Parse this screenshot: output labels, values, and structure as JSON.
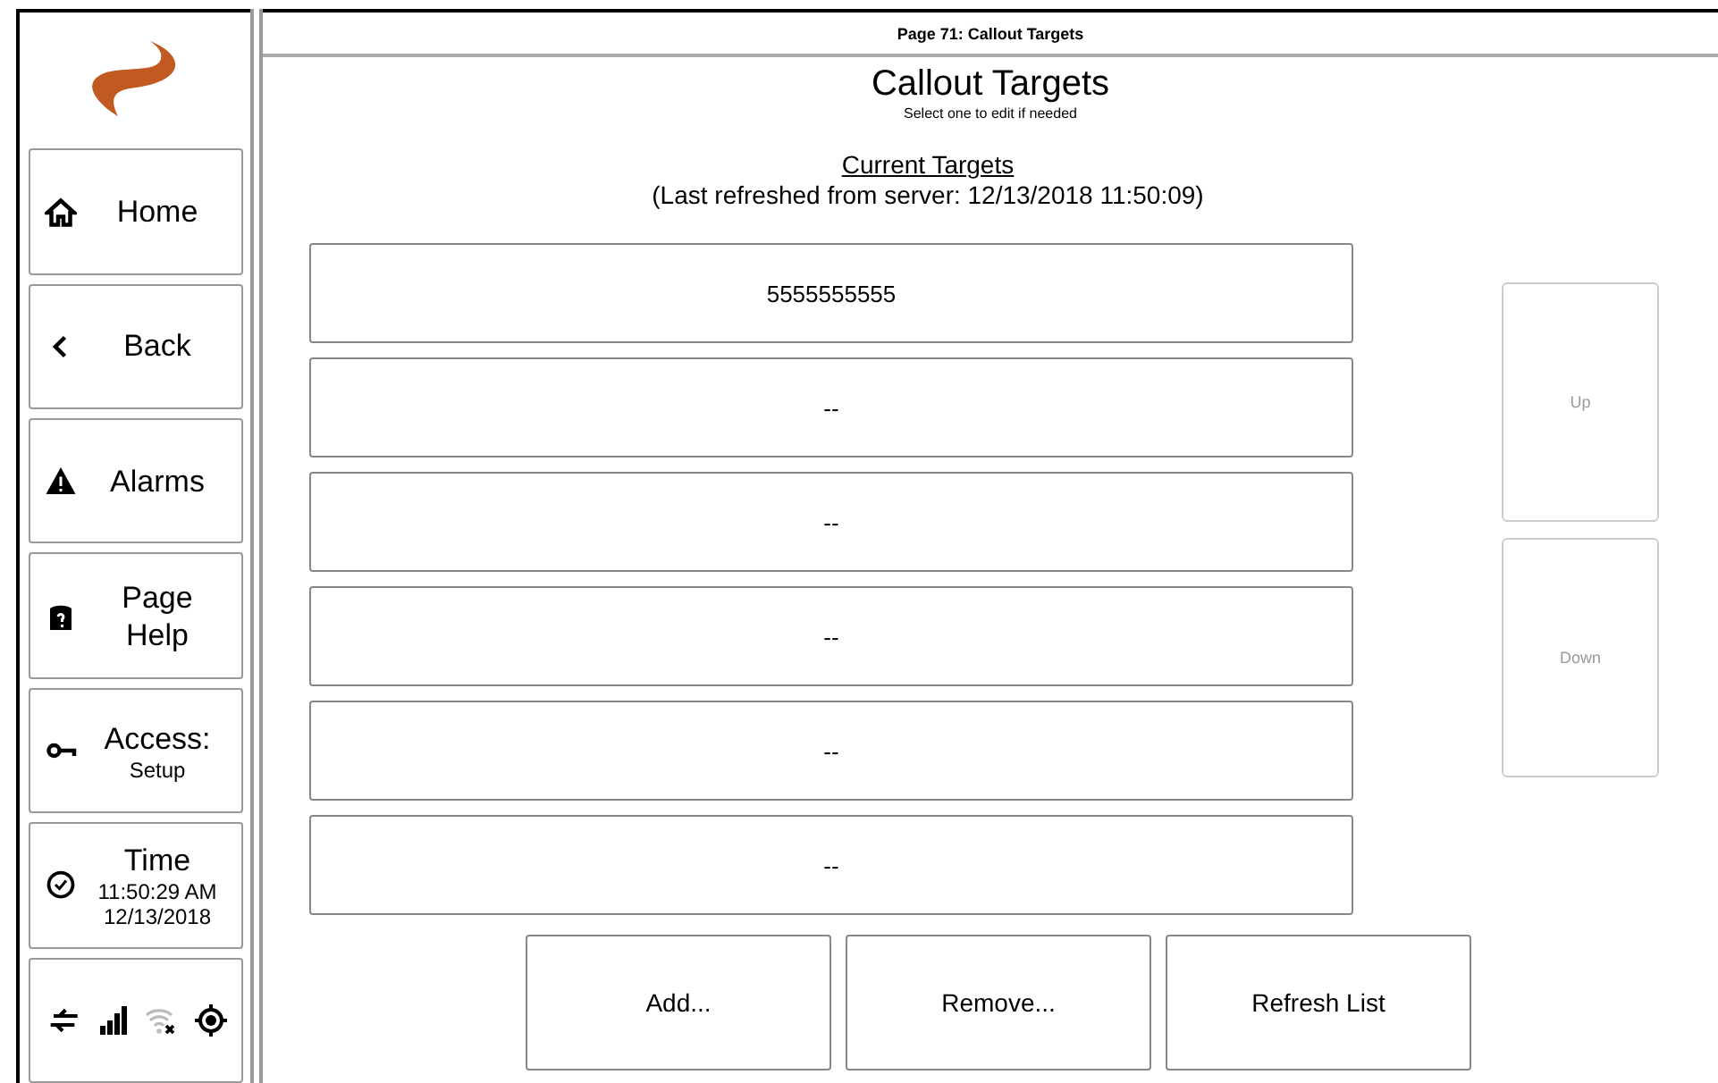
{
  "page_title": "Page 71: Callout Targets",
  "heading": "Callout Targets",
  "subheading": "Select one to edit if needed",
  "section_title": "Current Targets",
  "refresh_note": "(Last refreshed from server: 12/13/2018 11:50:09)",
  "sidebar": [
    {
      "kind": "home",
      "lines": [
        "Home"
      ]
    },
    {
      "kind": "back",
      "lines": [
        "Back"
      ]
    },
    {
      "kind": "alarm",
      "lines": [
        "Alarms"
      ]
    },
    {
      "kind": "help",
      "lines": [
        "Page",
        "Help"
      ]
    },
    {
      "kind": "access",
      "lines": [
        "Access:"
      ],
      "small": [
        "Setup"
      ]
    },
    {
      "kind": "time",
      "lines": [
        "Time"
      ],
      "small": [
        "11:50:29 AM",
        "12/13/2018"
      ]
    }
  ],
  "status": {
    "wifi_connected": false
  },
  "targets": [
    "5555555555",
    "--",
    "--",
    "--",
    "--",
    "--"
  ],
  "nav_buttons": [
    {
      "label": "Up",
      "disabled": true
    },
    {
      "label": "Down",
      "disabled": true
    }
  ],
  "actions": [
    "Add...",
    "Remove...",
    "Refresh List"
  ]
}
